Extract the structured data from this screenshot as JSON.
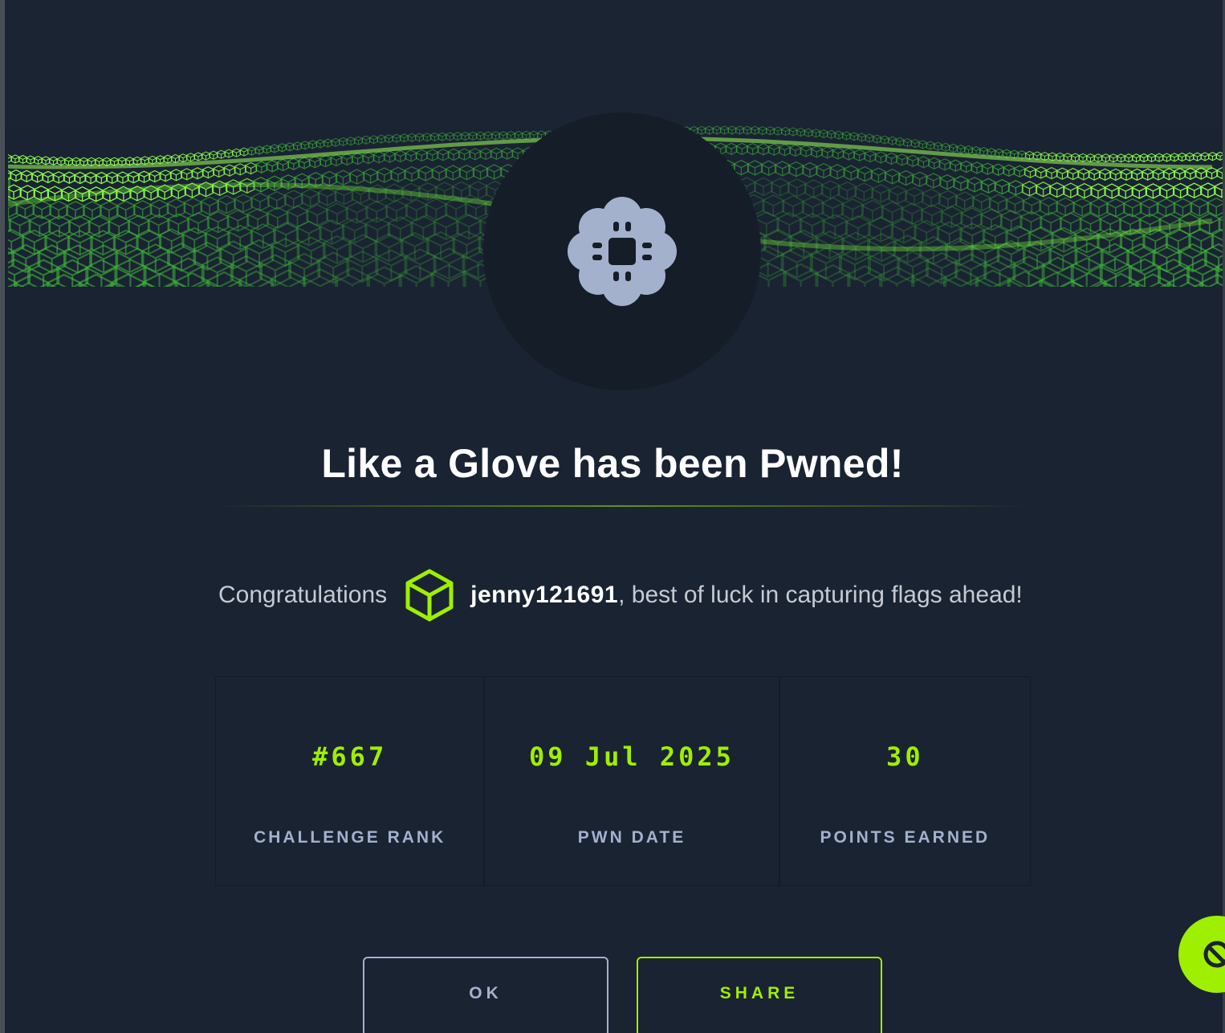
{
  "modal": {
    "title": "Like a Glove has been Pwned!",
    "avatar_icon": "chip-badge-icon",
    "congrats_prefix": "Congratulations",
    "user_icon": "cube-icon",
    "username": "jenny121691",
    "congrats_suffix": ", best of luck in capturing flags ahead!"
  },
  "stats": [
    {
      "value": "#667",
      "label": "CHALLENGE RANK"
    },
    {
      "value": "09 Jul 2025",
      "label": "PWN DATE"
    },
    {
      "value": "30",
      "label": "POINTS EARNED"
    }
  ],
  "buttons": {
    "ok_label": "OK",
    "share_label": "SHARE"
  },
  "fab_icon": "support-chat-icon",
  "colors": {
    "background": "#1a2332",
    "accent": "#9fef00",
    "muted_text": "#a4b1cd",
    "avatar_circle": "#151d29",
    "avatar_icon_fill": "#a4b1cd"
  }
}
